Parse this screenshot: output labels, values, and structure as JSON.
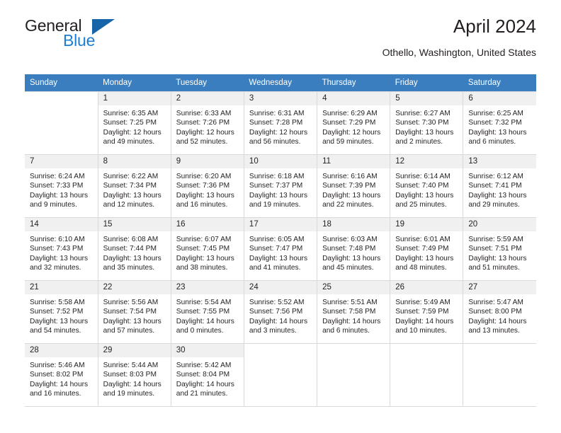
{
  "brand": {
    "name_top": "General",
    "name_bottom": "Blue",
    "triangle_color": "#1565a8",
    "blue_color": "#1c7fd4"
  },
  "header": {
    "title": "April 2024",
    "location": "Othello, Washington, United States"
  },
  "calendar": {
    "header_bg": "#3a7ebf",
    "weekday_headers": [
      "Sunday",
      "Monday",
      "Tuesday",
      "Wednesday",
      "Thursday",
      "Friday",
      "Saturday"
    ],
    "weeks": [
      [
        {
          "day": "",
          "lines": []
        },
        {
          "day": "1",
          "lines": [
            "Sunrise: 6:35 AM",
            "Sunset: 7:25 PM",
            "Daylight: 12 hours",
            "and 49 minutes."
          ]
        },
        {
          "day": "2",
          "lines": [
            "Sunrise: 6:33 AM",
            "Sunset: 7:26 PM",
            "Daylight: 12 hours",
            "and 52 minutes."
          ]
        },
        {
          "day": "3",
          "lines": [
            "Sunrise: 6:31 AM",
            "Sunset: 7:28 PM",
            "Daylight: 12 hours",
            "and 56 minutes."
          ]
        },
        {
          "day": "4",
          "lines": [
            "Sunrise: 6:29 AM",
            "Sunset: 7:29 PM",
            "Daylight: 12 hours",
            "and 59 minutes."
          ]
        },
        {
          "day": "5",
          "lines": [
            "Sunrise: 6:27 AM",
            "Sunset: 7:30 PM",
            "Daylight: 13 hours",
            "and 2 minutes."
          ]
        },
        {
          "day": "6",
          "lines": [
            "Sunrise: 6:25 AM",
            "Sunset: 7:32 PM",
            "Daylight: 13 hours",
            "and 6 minutes."
          ]
        }
      ],
      [
        {
          "day": "7",
          "lines": [
            "Sunrise: 6:24 AM",
            "Sunset: 7:33 PM",
            "Daylight: 13 hours",
            "and 9 minutes."
          ]
        },
        {
          "day": "8",
          "lines": [
            "Sunrise: 6:22 AM",
            "Sunset: 7:34 PM",
            "Daylight: 13 hours",
            "and 12 minutes."
          ]
        },
        {
          "day": "9",
          "lines": [
            "Sunrise: 6:20 AM",
            "Sunset: 7:36 PM",
            "Daylight: 13 hours",
            "and 16 minutes."
          ]
        },
        {
          "day": "10",
          "lines": [
            "Sunrise: 6:18 AM",
            "Sunset: 7:37 PM",
            "Daylight: 13 hours",
            "and 19 minutes."
          ]
        },
        {
          "day": "11",
          "lines": [
            "Sunrise: 6:16 AM",
            "Sunset: 7:39 PM",
            "Daylight: 13 hours",
            "and 22 minutes."
          ]
        },
        {
          "day": "12",
          "lines": [
            "Sunrise: 6:14 AM",
            "Sunset: 7:40 PM",
            "Daylight: 13 hours",
            "and 25 minutes."
          ]
        },
        {
          "day": "13",
          "lines": [
            "Sunrise: 6:12 AM",
            "Sunset: 7:41 PM",
            "Daylight: 13 hours",
            "and 29 minutes."
          ]
        }
      ],
      [
        {
          "day": "14",
          "lines": [
            "Sunrise: 6:10 AM",
            "Sunset: 7:43 PM",
            "Daylight: 13 hours",
            "and 32 minutes."
          ]
        },
        {
          "day": "15",
          "lines": [
            "Sunrise: 6:08 AM",
            "Sunset: 7:44 PM",
            "Daylight: 13 hours",
            "and 35 minutes."
          ]
        },
        {
          "day": "16",
          "lines": [
            "Sunrise: 6:07 AM",
            "Sunset: 7:45 PM",
            "Daylight: 13 hours",
            "and 38 minutes."
          ]
        },
        {
          "day": "17",
          "lines": [
            "Sunrise: 6:05 AM",
            "Sunset: 7:47 PM",
            "Daylight: 13 hours",
            "and 41 minutes."
          ]
        },
        {
          "day": "18",
          "lines": [
            "Sunrise: 6:03 AM",
            "Sunset: 7:48 PM",
            "Daylight: 13 hours",
            "and 45 minutes."
          ]
        },
        {
          "day": "19",
          "lines": [
            "Sunrise: 6:01 AM",
            "Sunset: 7:49 PM",
            "Daylight: 13 hours",
            "and 48 minutes."
          ]
        },
        {
          "day": "20",
          "lines": [
            "Sunrise: 5:59 AM",
            "Sunset: 7:51 PM",
            "Daylight: 13 hours",
            "and 51 minutes."
          ]
        }
      ],
      [
        {
          "day": "21",
          "lines": [
            "Sunrise: 5:58 AM",
            "Sunset: 7:52 PM",
            "Daylight: 13 hours",
            "and 54 minutes."
          ]
        },
        {
          "day": "22",
          "lines": [
            "Sunrise: 5:56 AM",
            "Sunset: 7:54 PM",
            "Daylight: 13 hours",
            "and 57 minutes."
          ]
        },
        {
          "day": "23",
          "lines": [
            "Sunrise: 5:54 AM",
            "Sunset: 7:55 PM",
            "Daylight: 14 hours",
            "and 0 minutes."
          ]
        },
        {
          "day": "24",
          "lines": [
            "Sunrise: 5:52 AM",
            "Sunset: 7:56 PM",
            "Daylight: 14 hours",
            "and 3 minutes."
          ]
        },
        {
          "day": "25",
          "lines": [
            "Sunrise: 5:51 AM",
            "Sunset: 7:58 PM",
            "Daylight: 14 hours",
            "and 6 minutes."
          ]
        },
        {
          "day": "26",
          "lines": [
            "Sunrise: 5:49 AM",
            "Sunset: 7:59 PM",
            "Daylight: 14 hours",
            "and 10 minutes."
          ]
        },
        {
          "day": "27",
          "lines": [
            "Sunrise: 5:47 AM",
            "Sunset: 8:00 PM",
            "Daylight: 14 hours",
            "and 13 minutes."
          ]
        }
      ],
      [
        {
          "day": "28",
          "lines": [
            "Sunrise: 5:46 AM",
            "Sunset: 8:02 PM",
            "Daylight: 14 hours",
            "and 16 minutes."
          ]
        },
        {
          "day": "29",
          "lines": [
            "Sunrise: 5:44 AM",
            "Sunset: 8:03 PM",
            "Daylight: 14 hours",
            "and 19 minutes."
          ]
        },
        {
          "day": "30",
          "lines": [
            "Sunrise: 5:42 AM",
            "Sunset: 8:04 PM",
            "Daylight: 14 hours",
            "and 21 minutes."
          ]
        },
        {
          "day": "",
          "lines": []
        },
        {
          "day": "",
          "lines": []
        },
        {
          "day": "",
          "lines": []
        },
        {
          "day": "",
          "lines": []
        }
      ]
    ]
  }
}
